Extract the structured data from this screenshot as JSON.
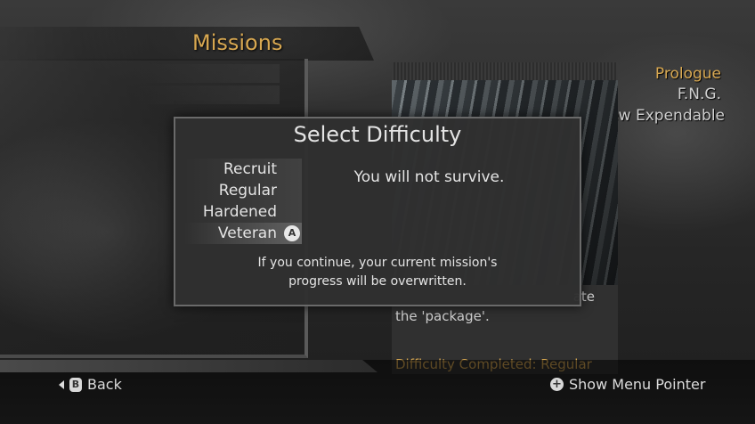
{
  "page": {
    "title": "Missions"
  },
  "missions": {
    "items": [
      {
        "label": "Prologue",
        "selected": true
      },
      {
        "label": "F.N.G.",
        "selected": false
      },
      {
        "label": "Crew Expendable",
        "selected": false
      }
    ]
  },
  "preview": {
    "description_line1": "ate",
    "description_line2": "the 'package'.",
    "difficulty_completed": "Difficulty Completed: Regular"
  },
  "dialog": {
    "title": "Select Difficulty",
    "options": [
      {
        "label": "Recruit"
      },
      {
        "label": "Regular"
      },
      {
        "label": "Hardened"
      },
      {
        "label": "Veteran",
        "selected": true,
        "button": "A"
      }
    ],
    "selected_description": "You will not survive.",
    "warning_line1": "If you continue, your current mission's",
    "warning_line2": "progress will be overwritten."
  },
  "footer": {
    "back_button": "B",
    "back_label": "Back",
    "pointer_button": "+",
    "pointer_label": "Show Menu Pointer"
  },
  "colors": {
    "accent": "#d8a851",
    "text": "#e4e4e4"
  }
}
